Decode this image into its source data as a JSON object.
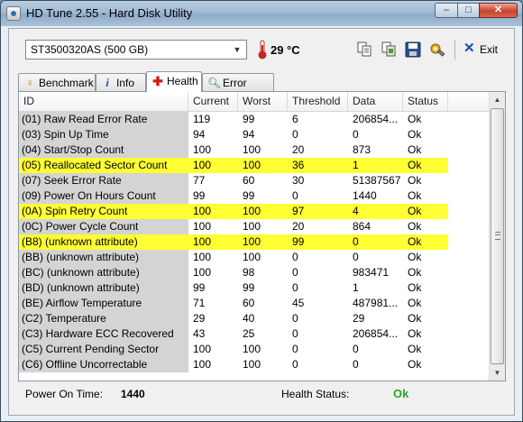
{
  "window": {
    "title": "HD Tune 2.55 - Hard Disk Utility",
    "min": "–",
    "max": "□",
    "close": "✕"
  },
  "toolbar": {
    "drive": "ST3500320AS (500 GB)",
    "temperature": "29 °C",
    "exit_label": "Exit",
    "icons": [
      "copy-icon",
      "copy-screenshot-icon",
      "save-icon",
      "options-icon"
    ]
  },
  "tabs": [
    {
      "label": "Benchmark",
      "icon": "benchmark-icon",
      "active": false
    },
    {
      "label": "Info",
      "icon": "info-icon",
      "active": false
    },
    {
      "label": "Health",
      "icon": "health-icon",
      "active": true
    },
    {
      "label": "Error Scan",
      "icon": "error-scan-icon",
      "active": false
    }
  ],
  "table": {
    "headers": [
      "ID",
      "Current",
      "Worst",
      "Threshold",
      "Data",
      "Status"
    ],
    "rows": [
      {
        "id": "(01) Raw Read Error Rate",
        "current": "119",
        "worst": "99",
        "threshold": "6",
        "data": "206854...",
        "status": "Ok",
        "highlight": false
      },
      {
        "id": "(03) Spin Up Time",
        "current": "94",
        "worst": "94",
        "threshold": "0",
        "data": "0",
        "status": "Ok",
        "highlight": false
      },
      {
        "id": "(04) Start/Stop Count",
        "current": "100",
        "worst": "100",
        "threshold": "20",
        "data": "873",
        "status": "Ok",
        "highlight": false
      },
      {
        "id": "(05) Reallocated Sector Count",
        "current": "100",
        "worst": "100",
        "threshold": "36",
        "data": "1",
        "status": "Ok",
        "highlight": true
      },
      {
        "id": "(07) Seek Error Rate",
        "current": "77",
        "worst": "60",
        "threshold": "30",
        "data": "51387567",
        "status": "Ok",
        "highlight": false
      },
      {
        "id": "(09) Power On Hours Count",
        "current": "99",
        "worst": "99",
        "threshold": "0",
        "data": "1440",
        "status": "Ok",
        "highlight": false
      },
      {
        "id": "(0A) Spin Retry Count",
        "current": "100",
        "worst": "100",
        "threshold": "97",
        "data": "4",
        "status": "Ok",
        "highlight": true
      },
      {
        "id": "(0C) Power Cycle Count",
        "current": "100",
        "worst": "100",
        "threshold": "20",
        "data": "864",
        "status": "Ok",
        "highlight": false
      },
      {
        "id": "(B8) (unknown attribute)",
        "current": "100",
        "worst": "100",
        "threshold": "99",
        "data": "0",
        "status": "Ok",
        "highlight": true
      },
      {
        "id": "(BB) (unknown attribute)",
        "current": "100",
        "worst": "100",
        "threshold": "0",
        "data": "0",
        "status": "Ok",
        "highlight": false
      },
      {
        "id": "(BC) (unknown attribute)",
        "current": "100",
        "worst": "98",
        "threshold": "0",
        "data": "983471",
        "status": "Ok",
        "highlight": false
      },
      {
        "id": "(BD) (unknown attribute)",
        "current": "99",
        "worst": "99",
        "threshold": "0",
        "data": "1",
        "status": "Ok",
        "highlight": false
      },
      {
        "id": "(BE) Airflow Temperature",
        "current": "71",
        "worst": "60",
        "threshold": "45",
        "data": "487981...",
        "status": "Ok",
        "highlight": false
      },
      {
        "id": "(C2) Temperature",
        "current": "29",
        "worst": "40",
        "threshold": "0",
        "data": "29",
        "status": "Ok",
        "highlight": false
      },
      {
        "id": "(C3) Hardware ECC Recovered",
        "current": "43",
        "worst": "25",
        "threshold": "0",
        "data": "206854...",
        "status": "Ok",
        "highlight": false
      },
      {
        "id": "(C5) Current Pending Sector",
        "current": "100",
        "worst": "100",
        "threshold": "0",
        "data": "0",
        "status": "Ok",
        "highlight": false
      },
      {
        "id": "(C6) Offline Uncorrectable",
        "current": "100",
        "worst": "100",
        "threshold": "0",
        "data": "0",
        "status": "Ok",
        "highlight": false
      }
    ]
  },
  "statusbar": {
    "power_on_label": "Power On Time:",
    "power_on_value": "1440",
    "health_label": "Health Status:",
    "health_value": "Ok"
  },
  "colors": {
    "highlight": "#ffff33",
    "ok": "#2aa52a",
    "accent": "#1a4fa3"
  }
}
